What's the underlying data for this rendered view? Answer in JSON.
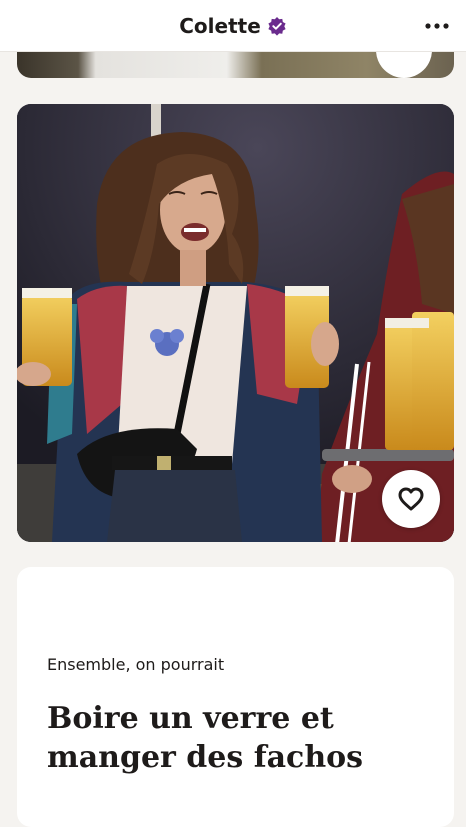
{
  "header": {
    "title": "Colette",
    "verified_icon": "verified-badge-icon",
    "more_icon": "more-options-icon",
    "accent_color": "#6a2b8d"
  },
  "profile": {
    "photo_alt_subject": "woman-holding-beers-photo",
    "like_icon": "heart-icon"
  },
  "prompt": {
    "label": "Ensemble, on pourrait",
    "answer": "Boire un verre et manger des fachos"
  }
}
